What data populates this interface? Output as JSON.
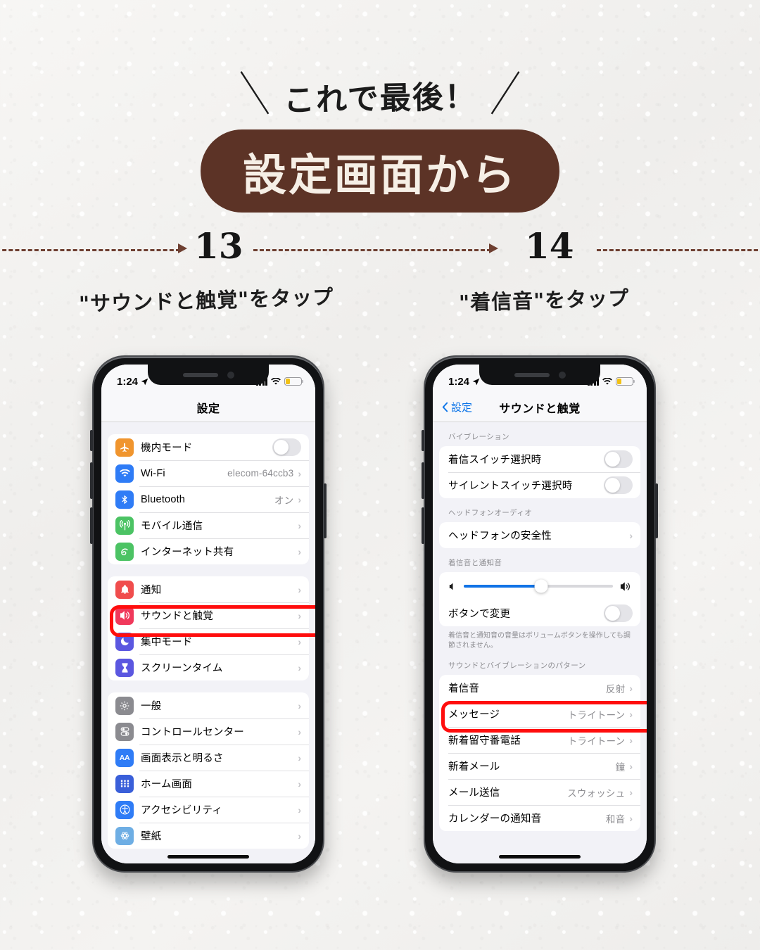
{
  "header": {
    "kicker": "これで最後！",
    "slash_left": "＼",
    "slash_right": "／",
    "pill_title": "設定画面から",
    "pill_color": "#5c3326"
  },
  "steps": [
    {
      "number": "13",
      "caption": "\"サウンドと触覚\"をタップ"
    },
    {
      "number": "14",
      "caption": "\"着信音\"をタップ"
    }
  ],
  "accent": {
    "highlight": "#ff0d0d",
    "ios_blue": "#0a73e8",
    "dashed": "#6e3f31"
  },
  "phone_left": {
    "status": {
      "time": "1:24",
      "location_icon": "location-arrow-icon",
      "signal_icon": "cellular-bars-icon",
      "wifi_icon": "wifi-icon",
      "battery_icon": "battery-low-icon",
      "battery_color": "#f2c115"
    },
    "nav": {
      "title": "設定"
    },
    "groups": [
      {
        "rows": [
          {
            "icon": "airplane-icon",
            "icon_color": "#f0952e",
            "label": "機内モード",
            "control": "toggle",
            "value": ""
          },
          {
            "icon": "wifi-icon",
            "icon_color": "#2f7cf6",
            "label": "Wi-Fi",
            "control": "chevron",
            "value": "elecom-64ccb3"
          },
          {
            "icon": "bluetooth-icon",
            "icon_color": "#2f7cf6",
            "label": "Bluetooth",
            "control": "chevron",
            "value": "オン"
          },
          {
            "icon": "cellular-icon",
            "icon_color": "#4cc364",
            "label": "モバイル通信",
            "control": "chevron",
            "value": ""
          },
          {
            "icon": "hotspot-icon",
            "icon_color": "#4cc364",
            "label": "インターネット共有",
            "control": "chevron",
            "value": ""
          }
        ]
      },
      {
        "rows": [
          {
            "icon": "bell-icon",
            "icon_color": "#f04d4d",
            "label": "通知",
            "control": "chevron",
            "value": ""
          },
          {
            "icon": "speaker-icon",
            "icon_color": "#f0395b",
            "label": "サウンドと触覚",
            "control": "chevron",
            "value": "",
            "highlighted": true
          },
          {
            "icon": "moon-icon",
            "icon_color": "#5b57e0",
            "label": "集中モード",
            "control": "chevron",
            "value": ""
          },
          {
            "icon": "hourglass-icon",
            "icon_color": "#5b57e0",
            "label": "スクリーンタイム",
            "control": "chevron",
            "value": ""
          }
        ]
      },
      {
        "rows": [
          {
            "icon": "gear-icon",
            "icon_color": "#8b8b90",
            "label": "一般",
            "control": "chevron",
            "value": ""
          },
          {
            "icon": "control-center-icon",
            "icon_color": "#8b8b90",
            "label": "コントロールセンター",
            "control": "chevron",
            "value": ""
          },
          {
            "icon": "display-aa-icon",
            "icon_color": "#2f7cf6",
            "label": "画面表示と明るさ",
            "control": "chevron",
            "value": ""
          },
          {
            "icon": "home-screen-grid-icon",
            "icon_color": "#3a5fd9",
            "label": "ホーム画面",
            "control": "chevron",
            "value": ""
          },
          {
            "icon": "accessibility-icon",
            "icon_color": "#2f7cf6",
            "label": "アクセシビリティ",
            "control": "chevron",
            "value": ""
          },
          {
            "icon": "wallpaper-icon",
            "icon_color": "#6eaee4",
            "label": "壁紙",
            "control": "chevron",
            "value": ""
          }
        ]
      }
    ]
  },
  "phone_right": {
    "status": {
      "time": "1:24",
      "location_icon": "location-arrow-icon",
      "signal_icon": "cellular-bars-icon",
      "wifi_icon": "wifi-icon",
      "battery_icon": "battery-low-icon",
      "battery_color": "#f2c115"
    },
    "nav": {
      "back_label": "設定",
      "title": "サウンドと触覚"
    },
    "sections": [
      {
        "header": "バイブレーション",
        "rows": [
          {
            "label": "着信スイッチ選択時",
            "control": "toggle",
            "value": ""
          },
          {
            "label": "サイレントスイッチ選択時",
            "control": "toggle",
            "value": ""
          }
        ]
      },
      {
        "header": "ヘッドフォンオーディオ",
        "rows": [
          {
            "label": "ヘッドフォンの安全性",
            "control": "chevron",
            "value": ""
          }
        ]
      },
      {
        "header": "着信音と通知音",
        "slider": {
          "value_percent": 52,
          "min_icon": "speaker-min-icon",
          "max_icon": "speaker-max-icon"
        },
        "rows": [
          {
            "label": "ボタンで変更",
            "control": "toggle",
            "value": ""
          }
        ],
        "footer": "着信音と通知音の音量はボリュームボタンを操作しても調節されません。"
      },
      {
        "header": "サウンドとバイブレーションのパターン",
        "rows": [
          {
            "label": "着信音",
            "control": "chevron",
            "value": "反射",
            "highlighted": true
          },
          {
            "label": "メッセージ",
            "control": "chevron",
            "value": "トライトーン"
          },
          {
            "label": "新着留守番電話",
            "control": "chevron",
            "value": "トライトーン"
          },
          {
            "label": "新着メール",
            "control": "chevron",
            "value": "鐘"
          },
          {
            "label": "メール送信",
            "control": "chevron",
            "value": "スウォッシュ"
          },
          {
            "label": "カレンダーの通知音",
            "control": "chevron",
            "value": "和音"
          }
        ]
      }
    ]
  }
}
